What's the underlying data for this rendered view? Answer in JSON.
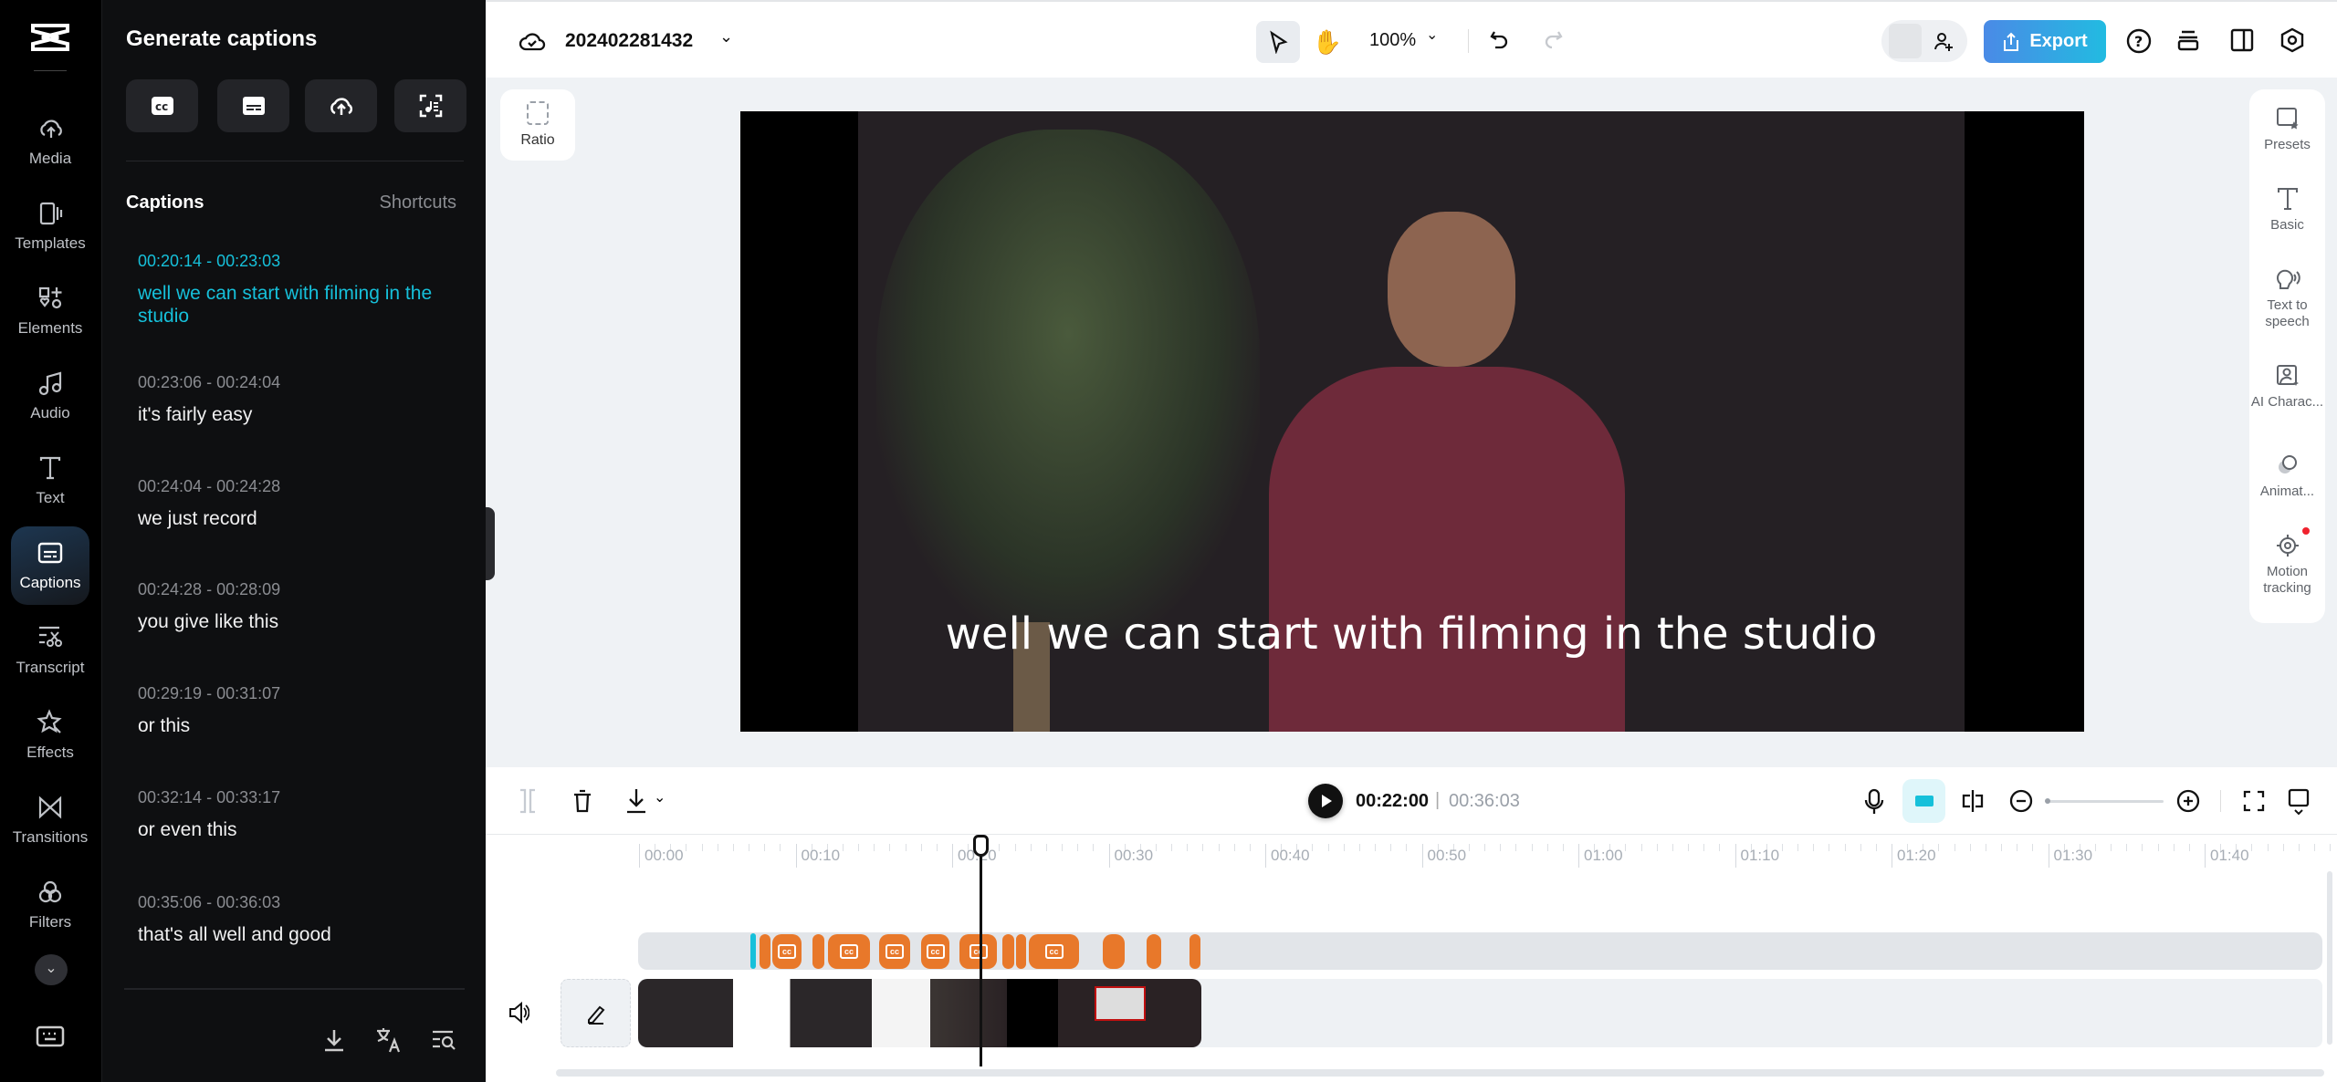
{
  "rail": {
    "items": [
      {
        "label": "Media",
        "icon": "cloud-upload-icon"
      },
      {
        "label": "Templates",
        "icon": "templates-icon"
      },
      {
        "label": "Elements",
        "icon": "elements-icon"
      },
      {
        "label": "Audio",
        "icon": "music-note-icon"
      },
      {
        "label": "Text",
        "icon": "text-icon"
      },
      {
        "label": "Captions",
        "icon": "captions-icon",
        "active": true
      },
      {
        "label": "Transcript",
        "icon": "transcript-icon"
      },
      {
        "label": "Effects",
        "icon": "effects-icon"
      },
      {
        "label": "Transitions",
        "icon": "transitions-icon"
      },
      {
        "label": "Filters",
        "icon": "filters-icon"
      }
    ]
  },
  "panel": {
    "title": "Generate captions",
    "section": "Captions",
    "shortcuts": "Shortcuts",
    "captions": [
      {
        "time": "00:20:14 - 00:23:03",
        "text": "well we can start with filming in the studio",
        "active": true
      },
      {
        "time": "00:23:06 - 00:24:04",
        "text": "it's fairly easy"
      },
      {
        "time": "00:24:04 - 00:24:28",
        "text": "we just record"
      },
      {
        "time": "00:24:28 - 00:28:09",
        "text": "you give like this"
      },
      {
        "time": "00:29:19 - 00:31:07",
        "text": "or this"
      },
      {
        "time": "00:32:14 - 00:33:17",
        "text": "or even this"
      },
      {
        "time": "00:35:06 - 00:36:03",
        "text": "that's all well and good"
      }
    ]
  },
  "topbar": {
    "project_name": "202402281432",
    "zoom": "100%",
    "export_label": "Export",
    "accent": "#2fb3e3"
  },
  "canvas": {
    "ratio_label": "Ratio",
    "caption_overlay": "well we can start with filming in the studio"
  },
  "right_panel": {
    "items": [
      "Presets",
      "Basic",
      "Text to speech",
      "AI Charac...",
      "Animat...",
      "Motion tracking"
    ]
  },
  "timeline": {
    "current_time": "00:22:00",
    "separator": "|",
    "total_time": "00:36:03",
    "ruler": [
      "00:00",
      "00:10",
      "00:20",
      "00:30",
      "00:40",
      "00:50",
      "01:00",
      "01:10",
      "01:20",
      "01:30",
      "01:40"
    ],
    "caption_color": "#e8782a"
  }
}
